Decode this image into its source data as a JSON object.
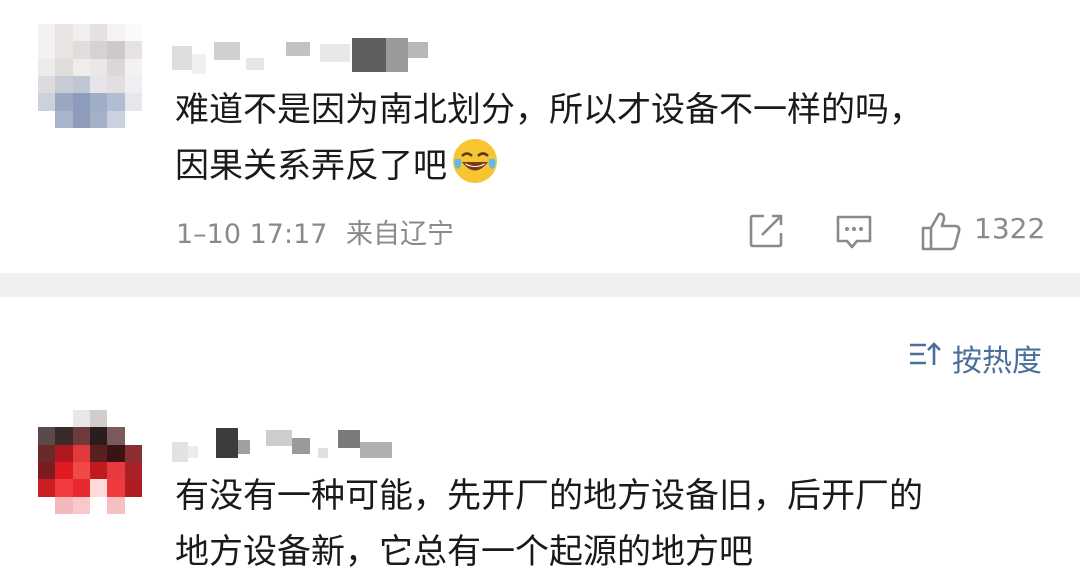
{
  "comments": [
    {
      "text_line1": "难道不是因为南北划分，所以才设备不一样的吗，",
      "text_line2": "因果关系弄反了吧",
      "emoji": "laughing-crying-emoji",
      "date": "1–10 17:17",
      "location": "来自辽宁",
      "like_count": "1322"
    },
    {
      "text_line1": "有没有一种可能，先开厂的地方设备旧，后开厂的",
      "text_line2": "地方设备新，它总有一个起源的地方吧"
    }
  ],
  "sort": {
    "icon": "sort-icon",
    "label": "按热度"
  },
  "colors": {
    "text": "#1a1a1a",
    "meta": "#8a8a8a",
    "link": "#4a6f9b",
    "divider": "#eef0f2"
  }
}
